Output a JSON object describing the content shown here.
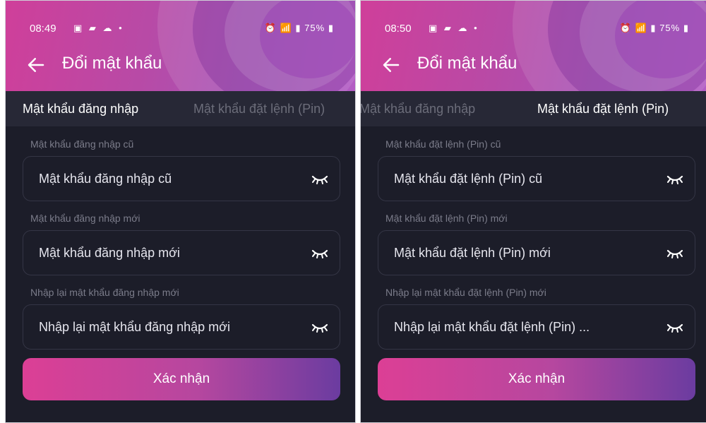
{
  "screens": [
    {
      "status": {
        "time": "08:49",
        "right": "75%"
      },
      "title": "Đổi mật khẩu",
      "tabs": [
        {
          "label": "Mật khẩu đăng nhập",
          "active": true
        },
        {
          "label": "Mật khẩu đặt lệnh (Pin)",
          "active": false
        }
      ],
      "fields": [
        {
          "label": "Mật khẩu đăng nhập cũ",
          "placeholder": "Mật khẩu đăng nhập cũ"
        },
        {
          "label": "Mật khẩu đăng nhập mới",
          "placeholder": "Mật khẩu đăng nhập mới"
        },
        {
          "label": "Nhập lại mật khẩu đăng nhập mới",
          "placeholder": "Nhập lại mật khẩu đăng nhập mới"
        }
      ],
      "button": "Xác nhận"
    },
    {
      "status": {
        "time": "08:50",
        "right": "75%"
      },
      "title": "Đổi mật khẩu",
      "tabs": [
        {
          "label": "Mật khẩu đăng nhập",
          "active": false
        },
        {
          "label": "Mật khẩu đặt lệnh (Pin)",
          "active": true
        }
      ],
      "fields": [
        {
          "label": "Mật khẩu đặt lệnh (Pin) cũ",
          "placeholder": "Mật khẩu đặt lệnh (Pin) cũ"
        },
        {
          "label": "Mật khẩu đặt lệnh (Pin) mới",
          "placeholder": "Mật khẩu đặt lệnh (Pin) mới"
        },
        {
          "label": "Nhập lại mật khẩu đặt lệnh (Pin) mới",
          "placeholder": "Nhập lại mật khẩu đặt lệnh (Pin) ..."
        }
      ],
      "button": "Xác nhận"
    }
  ],
  "icons": {
    "back": "arrow-left-icon",
    "eye": "eye-closed-icon",
    "status_left": "notification-icons",
    "status_right": "system-status-icons"
  },
  "colors": {
    "background": "#1c1d29",
    "tab_bar": "#272836",
    "accent_start": "#dc3f95",
    "accent_end": "#6b3ca0",
    "inactive_text": "#6c6d7a"
  }
}
